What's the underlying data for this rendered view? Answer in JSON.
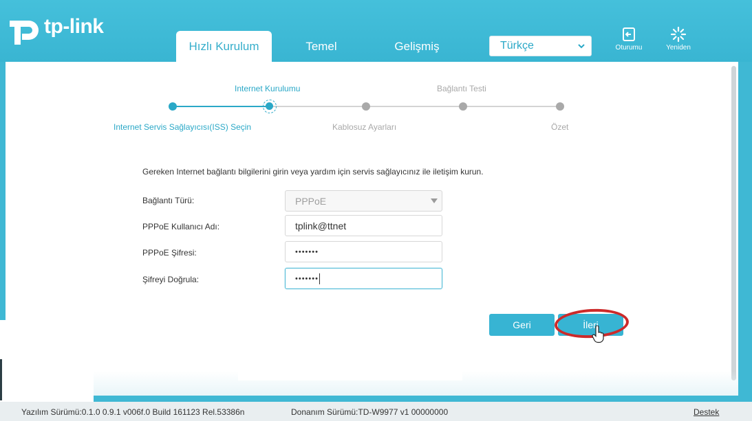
{
  "brand": {
    "name": "tp-link"
  },
  "nav": {
    "tabs": [
      {
        "label": "Hızlı Kurulum",
        "active": true
      },
      {
        "label": "Temel",
        "active": false
      },
      {
        "label": "Gelişmiş",
        "active": false
      }
    ],
    "language": "Türkçe",
    "logout_label": "Oturumu",
    "reboot_label": "Yeniden"
  },
  "wizard": {
    "steps_top": [
      "Internet Kurulumu",
      "Bağlantı Testi"
    ],
    "steps_bottom": [
      "Internet Servis Sağlayıcısı(ISS) Seçin",
      "Kablosuz Ayarları",
      "Özet"
    ],
    "current_step": 2,
    "total_steps": 5
  },
  "form": {
    "intro": "Gereken Internet bağlantı bilgilerini girin veya yardım için servis sağlayıcınız ile iletişim kurun.",
    "connection_type_label": "Bağlantı Türü:",
    "connection_type_value": "PPPoE",
    "username_label": "PPPoE Kullanıcı Adı:",
    "username_value": "tplink@ttnet",
    "password_label": "PPPoE Şifresi:",
    "password_value": "•••••••",
    "confirm_label": "Şifreyi Doğrula:",
    "confirm_value": "•••••••",
    "back_label": "Geri",
    "next_label": "İleri"
  },
  "footer": {
    "firmware": "Yazılım Sürümü:0.1.0 0.9.1 v006f.0 Build 161123 Rel.53386n",
    "hardware": "Donanım Sürümü:TD-W9977 v1 00000000",
    "support": "Destek"
  },
  "colors": {
    "header": "#3fb8d4",
    "accent": "#2aa8c7",
    "annotation": "#cc2a2a"
  }
}
